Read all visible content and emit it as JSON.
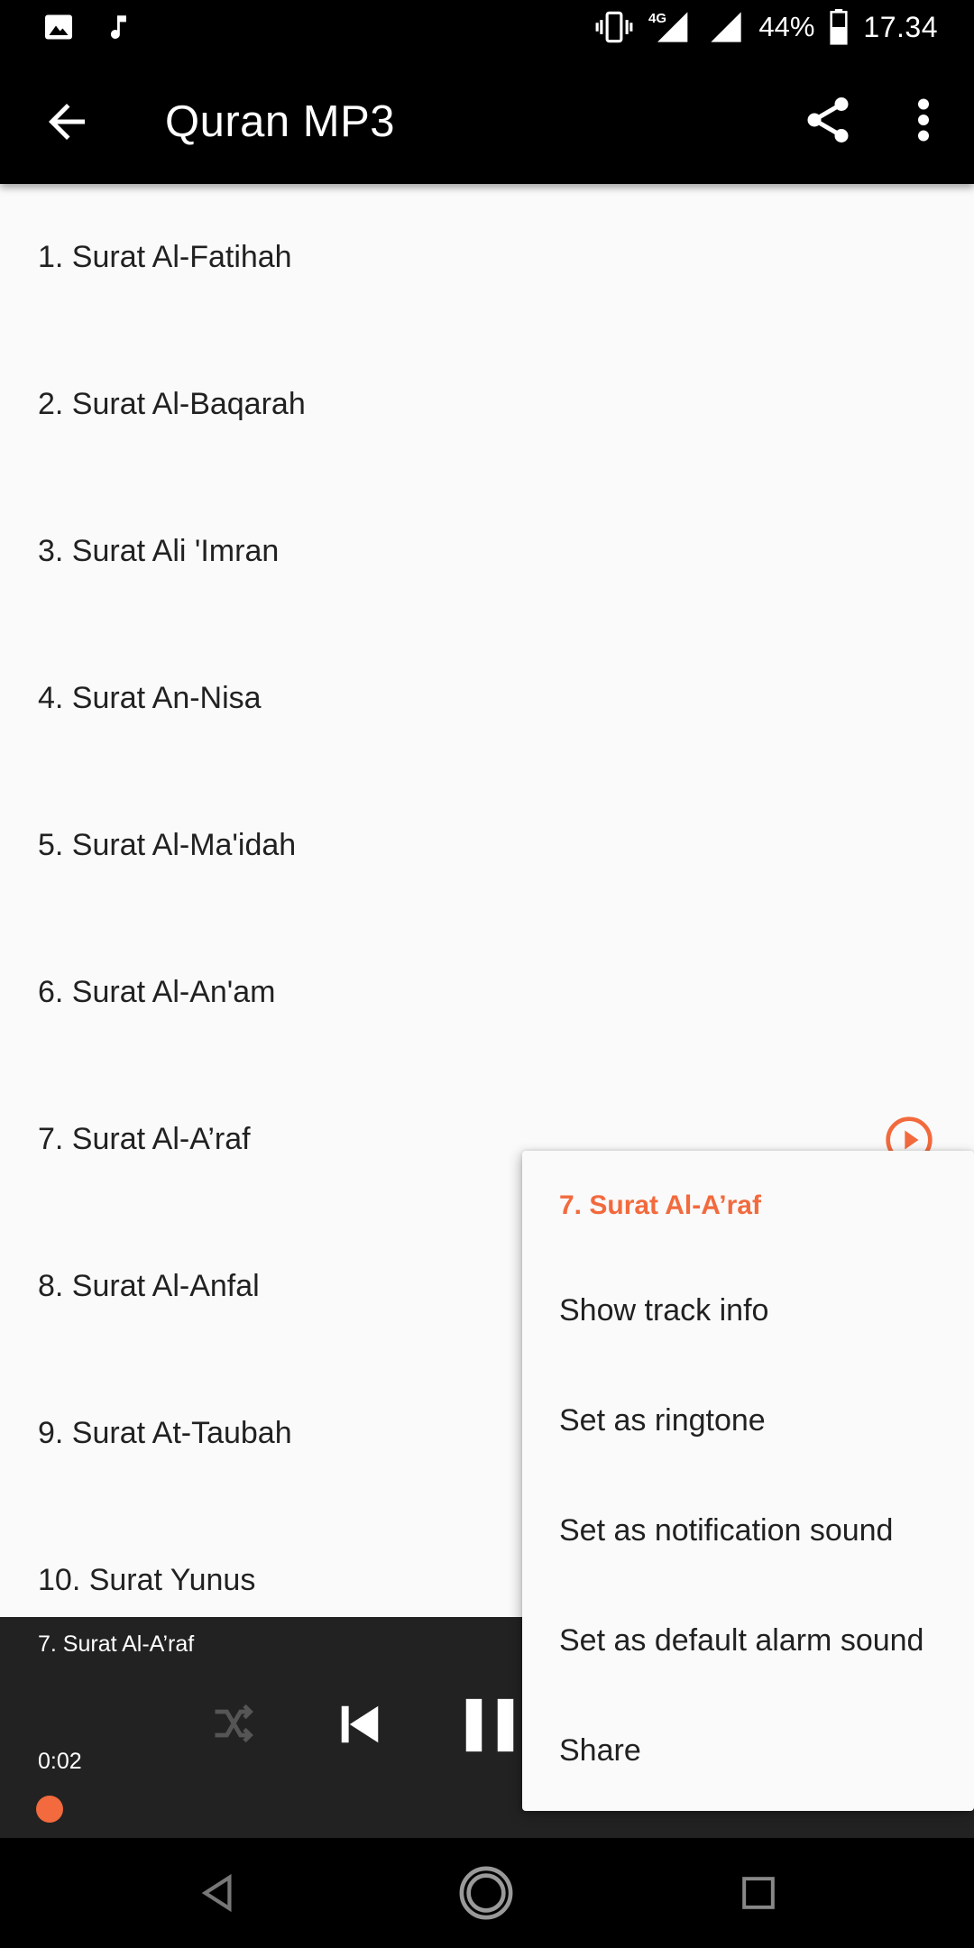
{
  "status_bar": {
    "battery_percent": "44%",
    "time": "17.34",
    "network": "4G",
    "icons": [
      "image-icon",
      "music-note-icon",
      "vibrate-icon",
      "signal-4g-icon",
      "signal-icon",
      "battery-icon"
    ]
  },
  "app_bar": {
    "title": "Quran MP3",
    "icons": [
      "back-arrow-icon",
      "share-icon",
      "more-vert-icon"
    ]
  },
  "list": {
    "items": [
      {
        "label": "1. Surat Al-Fatihah"
      },
      {
        "label": "2. Surat Al-Baqarah"
      },
      {
        "label": "3. Surat Ali 'Imran"
      },
      {
        "label": "4. Surat An-Nisa"
      },
      {
        "label": "5. Surat Al-Ma'idah"
      },
      {
        "label": "6. Surat Al-An'am"
      },
      {
        "label": "7. Surat Al-A’raf"
      },
      {
        "label": "8. Surat Al-Anfal"
      },
      {
        "label": "9. Surat At-Taubah"
      },
      {
        "label": "10. Surat Yunus"
      }
    ]
  },
  "player": {
    "track": "7. Surat Al-A’raf",
    "elapsed": "0:02",
    "state": "playing"
  },
  "menu": {
    "title": "7. Surat Al-A’raf",
    "items": [
      {
        "label": "Show track info"
      },
      {
        "label": "Set as ringtone"
      },
      {
        "label": "Set as notification sound"
      },
      {
        "label": "Set as default alarm sound"
      },
      {
        "label": "Share"
      }
    ]
  },
  "colors": {
    "accent": "#f26a3d",
    "bar_bg": "#000000",
    "player_bg": "#222222",
    "list_bg": "#fafafa"
  }
}
